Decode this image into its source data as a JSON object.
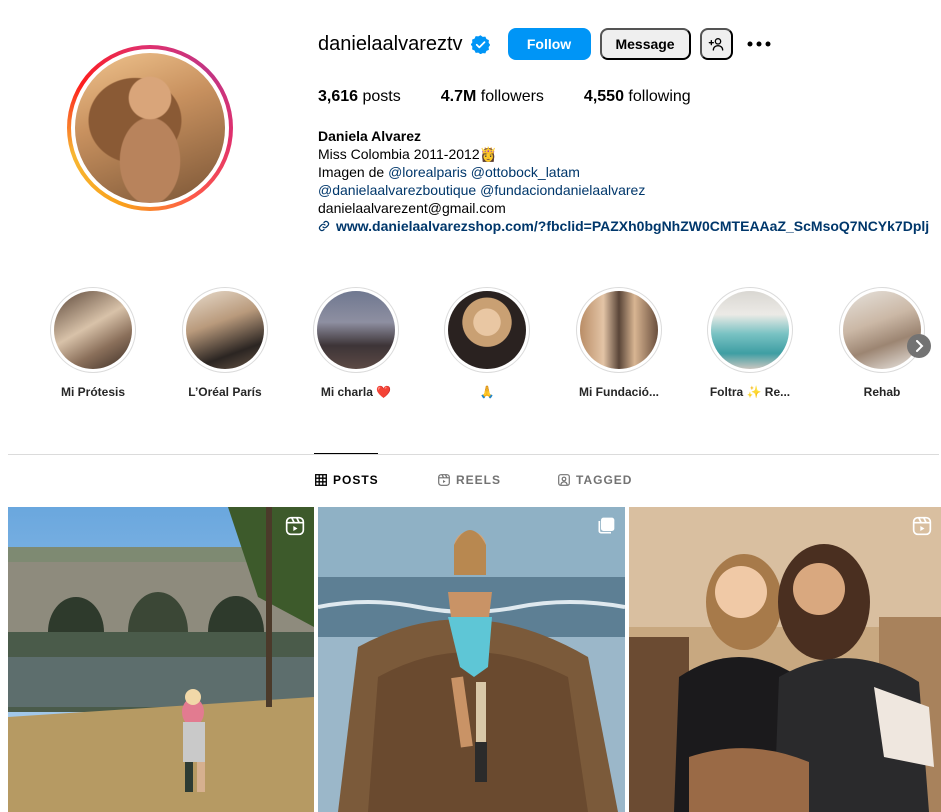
{
  "profile": {
    "username": "danielaalvareztv",
    "follow_label": "Follow",
    "message_label": "Message",
    "stats": {
      "posts_count": "3,616",
      "posts_label": "posts",
      "followers_count": "4.7M",
      "followers_label": "followers",
      "following_count": "4,550",
      "following_label": "following"
    },
    "bio": {
      "name": "Daniela Alvarez",
      "line1": "Miss Colombia 2011-2012👸",
      "line2_prefix": "Imagen de ",
      "mention1": "@lorealparis",
      "mention2": "@ottobock_latam",
      "mention3": "@danielaalvarezboutique",
      "mention4": "@fundaciondanielaalvarez",
      "email": "danielaalvarezent@gmail.com",
      "link": "www.danielaalvarezshop.com/?fbclid=PAZXh0bgNhZW0CMTEAAaZ_ScMsoQ7NCYk7Dplj"
    }
  },
  "highlights": [
    {
      "label": "Mi Prótesis"
    },
    {
      "label": "L’Oréal París"
    },
    {
      "label": "Mi charla ❤️"
    },
    {
      "label": "🙏"
    },
    {
      "label": "Mi Fundació..."
    },
    {
      "label": "Foltra ✨ Re..."
    },
    {
      "label": "Rehab"
    }
  ],
  "tabs": {
    "posts": "POSTS",
    "reels": "REELS",
    "tagged": "TAGGED"
  },
  "posts": [
    {
      "type": "reel",
      "icon": "reel-icon"
    },
    {
      "type": "carousel",
      "icon": "carousel-icon"
    },
    {
      "type": "reel",
      "icon": "reel-icon"
    }
  ],
  "colors": {
    "accent": "#0095f6",
    "link": "#00376b",
    "secondary_button": "#efefef",
    "verified": "#0095f6"
  }
}
